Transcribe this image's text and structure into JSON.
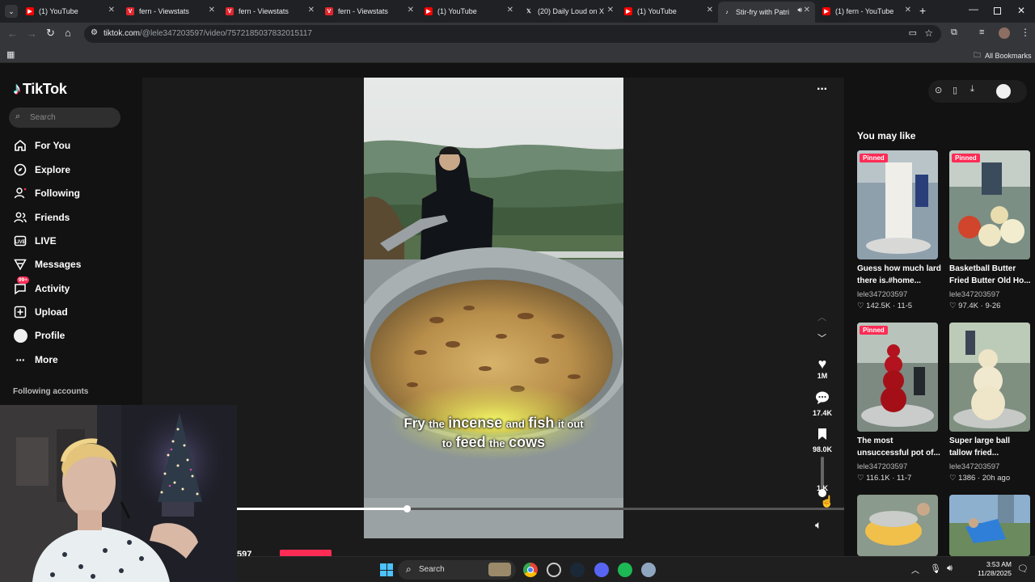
{
  "browser": {
    "tabs": [
      {
        "title": "(1) YouTube",
        "favicon": "youtube-icon"
      },
      {
        "title": "fern - Viewstats",
        "favicon": "viewstats-icon"
      },
      {
        "title": "fern - Viewstats",
        "favicon": "viewstats-icon"
      },
      {
        "title": "fern - Viewstats",
        "favicon": "viewstats-icon"
      },
      {
        "title": "(1) YouTube",
        "favicon": "youtube-icon"
      },
      {
        "title": "(20) Daily Loud on X",
        "favicon": "x-icon"
      },
      {
        "title": "(1) YouTube",
        "favicon": "youtube-icon"
      },
      {
        "title": "Stir-fry with Patri",
        "favicon": "tiktok-icon",
        "active": true
      },
      {
        "title": "(1) fern - YouTube",
        "favicon": "youtube-icon"
      }
    ],
    "url_host": "tiktok.com",
    "url_path": "/@lele347203597/video/7572185037832015117",
    "bookmarks_label": "All Bookmarks"
  },
  "sidebar": {
    "logo": "TikTok",
    "search_placeholder": "Search",
    "items": [
      {
        "label": "For You",
        "icon": "home-icon"
      },
      {
        "label": "Explore",
        "icon": "compass-icon"
      },
      {
        "label": "Following",
        "icon": "following-icon"
      },
      {
        "label": "Friends",
        "icon": "friends-icon"
      },
      {
        "label": "LIVE",
        "icon": "live-icon"
      },
      {
        "label": "Messages",
        "icon": "messages-icon"
      },
      {
        "label": "Activity",
        "icon": "activity-icon",
        "badge": "99+"
      },
      {
        "label": "Upload",
        "icon": "upload-icon"
      },
      {
        "label": "Profile",
        "icon": "profile-avatar"
      },
      {
        "label": "More",
        "icon": "more-icon"
      }
    ],
    "following_accounts": "Following accounts"
  },
  "video": {
    "caption_line1_parts": [
      "Fry",
      "the",
      "incense",
      "and",
      "fish",
      "it out"
    ],
    "caption_line2_parts": [
      "to",
      "feed",
      "the",
      "cows"
    ],
    "likes": "1M",
    "comments": "17.4K",
    "saves": "98.0K",
    "shares": "1 K",
    "progress": 0.28,
    "author_fragment": "597"
  },
  "recommendations": {
    "heading": "You may like",
    "cards": [
      {
        "title": "Guess how much lard there is.#home...",
        "user": "lele347203597",
        "likes": "142.5K",
        "date": "11-5",
        "pinned": "Pinned"
      },
      {
        "title": "Basketball Butter Fried Butter Old Ho...",
        "user": "lele347203597",
        "likes": "97.4K",
        "date": "9-26",
        "pinned": "Pinned"
      },
      {
        "title": "The most unsuccessful pot of...",
        "user": "lele347203597",
        "likes": "116.1K",
        "date": "11-7",
        "pinned": "Pinned"
      },
      {
        "title": "Super large ball tallow fried...",
        "user": "lele347203597",
        "likes": "1386",
        "date": "20h ago",
        "pinned": ""
      }
    ]
  },
  "taskbar": {
    "search_label": "Search",
    "time": "3:53 AM",
    "date": "11/28/2025"
  },
  "colors": {
    "tiktok_red": "#fe2c55",
    "caption_yellow": "#f6ff4a"
  }
}
